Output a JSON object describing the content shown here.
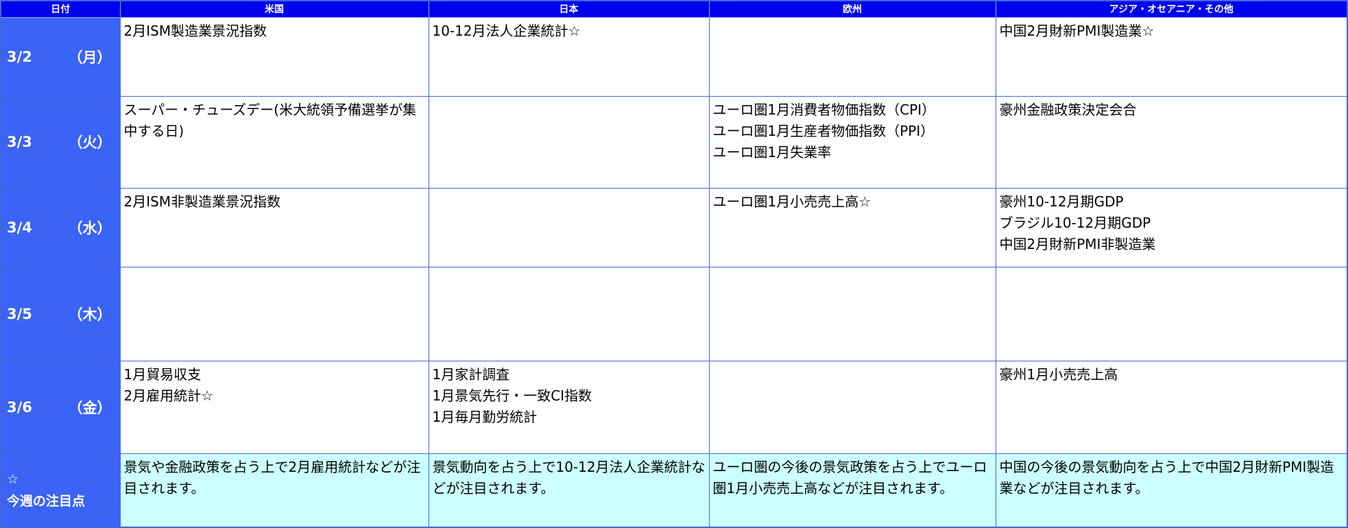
{
  "headers": [
    "日付",
    "米国",
    "日本",
    "欧州",
    "アジア・オセアニア・その他"
  ],
  "rows": [
    {
      "date": "3/2",
      "day": "（月）",
      "us": [
        "2月ISM製造業景況指数"
      ],
      "jp": [
        "10-12月法人企業統計☆"
      ],
      "eu": [],
      "asia": [
        "中国2月財新PMI製造業☆"
      ]
    },
    {
      "date": "3/3",
      "day": "（火）",
      "us": [
        "スーパー・チューズデー(米大統領予備選挙が集中する日)"
      ],
      "jp": [],
      "eu": [
        "ユーロ圏1月消費者物価指数（CPI）",
        "ユーロ圏1月生産者物価指数（PPI）",
        "ユーロ圏1月失業率"
      ],
      "asia": [
        "豪州金融政策決定会合"
      ]
    },
    {
      "date": "3/4",
      "day": "（水）",
      "us": [
        "2月ISM非製造業景況指数"
      ],
      "jp": [],
      "eu": [
        "ユーロ圏1月小売売上高☆"
      ],
      "asia": [
        "豪州10-12月期GDP",
        "ブラジル10-12月期GDP",
        "中国2月財新PMI非製造業"
      ]
    },
    {
      "date": "3/5",
      "day": "（木）",
      "us": [],
      "jp": [],
      "eu": [],
      "asia": []
    },
    {
      "date": "3/6",
      "day": "（金）",
      "us": [
        "1月貿易収支",
        "2月雇用統計☆"
      ],
      "jp": [
        "1月家計調査",
        "1月景気先行・一致CI指数",
        "1月毎月勤労統計"
      ],
      "eu": [],
      "asia": [
        "豪州1月小売売上高"
      ]
    }
  ],
  "focus": {
    "star": "☆",
    "label": "今週の注目点",
    "us": "景気や金融政策を占う上で2月雇用統計などが注目されます。",
    "jp": "景気動向を占う上で10-12月法人企業統計などが注目されます。",
    "eu": "ユーロ圏の今後の景気政策を占う上でユーロ圏1月小売売上高などが注目されます。",
    "asia": "中国の今後の景気動向を占う上で中国2月財新PMI製造業などが注目されます。"
  },
  "colors": {
    "header_bg": "#0000ee",
    "date_bg": "#3b63f5",
    "focus_bg": "#ccffff",
    "border": "#4466dd"
  }
}
